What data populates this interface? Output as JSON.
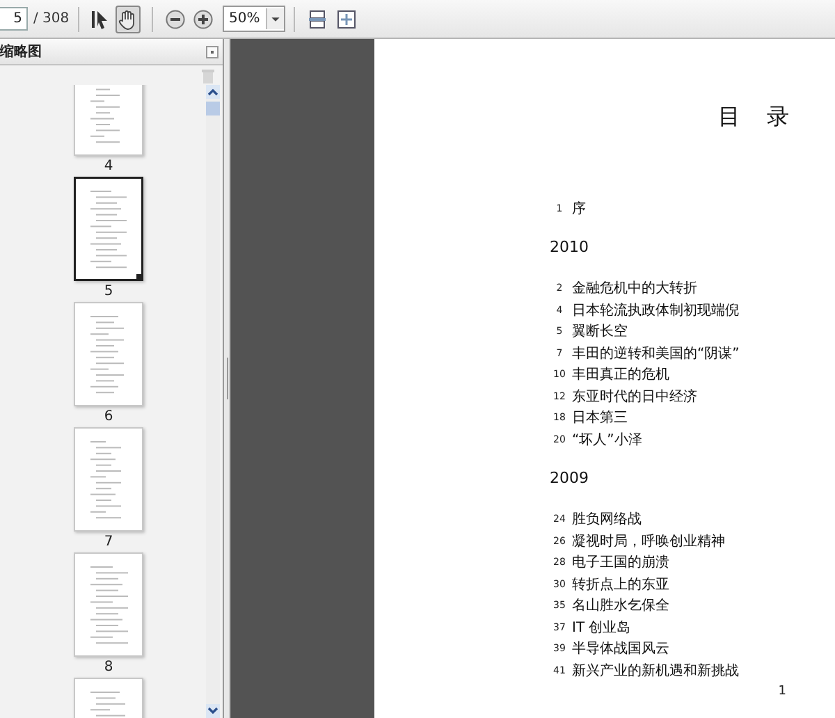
{
  "toolbar": {
    "page_number": "5",
    "page_count": "/ 308",
    "tools": [
      {
        "kind": "select",
        "selected": false
      },
      {
        "kind": "hand",
        "selected": true
      }
    ],
    "zoom": "50%"
  },
  "sidebar": {
    "title": "缩略图",
    "thumbnails": [
      {
        "label": "4",
        "selected": false
      },
      {
        "label": "5",
        "selected": true
      },
      {
        "label": "6",
        "selected": false
      },
      {
        "label": "7",
        "selected": false
      },
      {
        "label": "8",
        "selected": false
      },
      {
        "selected": false
      }
    ]
  },
  "document": {
    "heading": "目 录",
    "sections": [
      {
        "entries": [
          {
            "page": "1",
            "title": "序"
          }
        ]
      },
      {
        "year": "2010",
        "entries": [
          {
            "page": "2",
            "title": "金融危机中的大转折"
          },
          {
            "page": "4",
            "title": "日本轮流执政体制初现端倪"
          },
          {
            "page": "5",
            "title": "翼断长空"
          },
          {
            "page": "7",
            "title": "丰田的逆转和美国的“阴谋”"
          },
          {
            "page": "10",
            "title": "丰田真正的危机"
          },
          {
            "page": "12",
            "title": "东亚时代的日中经济"
          },
          {
            "page": "18",
            "title": "日本第三"
          },
          {
            "page": "20",
            "title": "“坏人”小泽"
          }
        ]
      },
      {
        "year": "2009",
        "entries": [
          {
            "page": "24",
            "title": "胜负网络战"
          },
          {
            "page": "26",
            "title": "凝视时局，呼唤创业精神"
          },
          {
            "page": "28",
            "title": "电子王国的崩溃"
          },
          {
            "page": "30",
            "title": "转折点上的东亚"
          },
          {
            "page": "35",
            "title": "名山胜水乞保全"
          },
          {
            "page": "37",
            "title": "IT 创业岛"
          },
          {
            "page": "39",
            "title": "半导体战国风云"
          },
          {
            "page": "41",
            "title": "新兴产业的新机遇和新挑战"
          }
        ]
      }
    ],
    "page_footer": "1"
  }
}
